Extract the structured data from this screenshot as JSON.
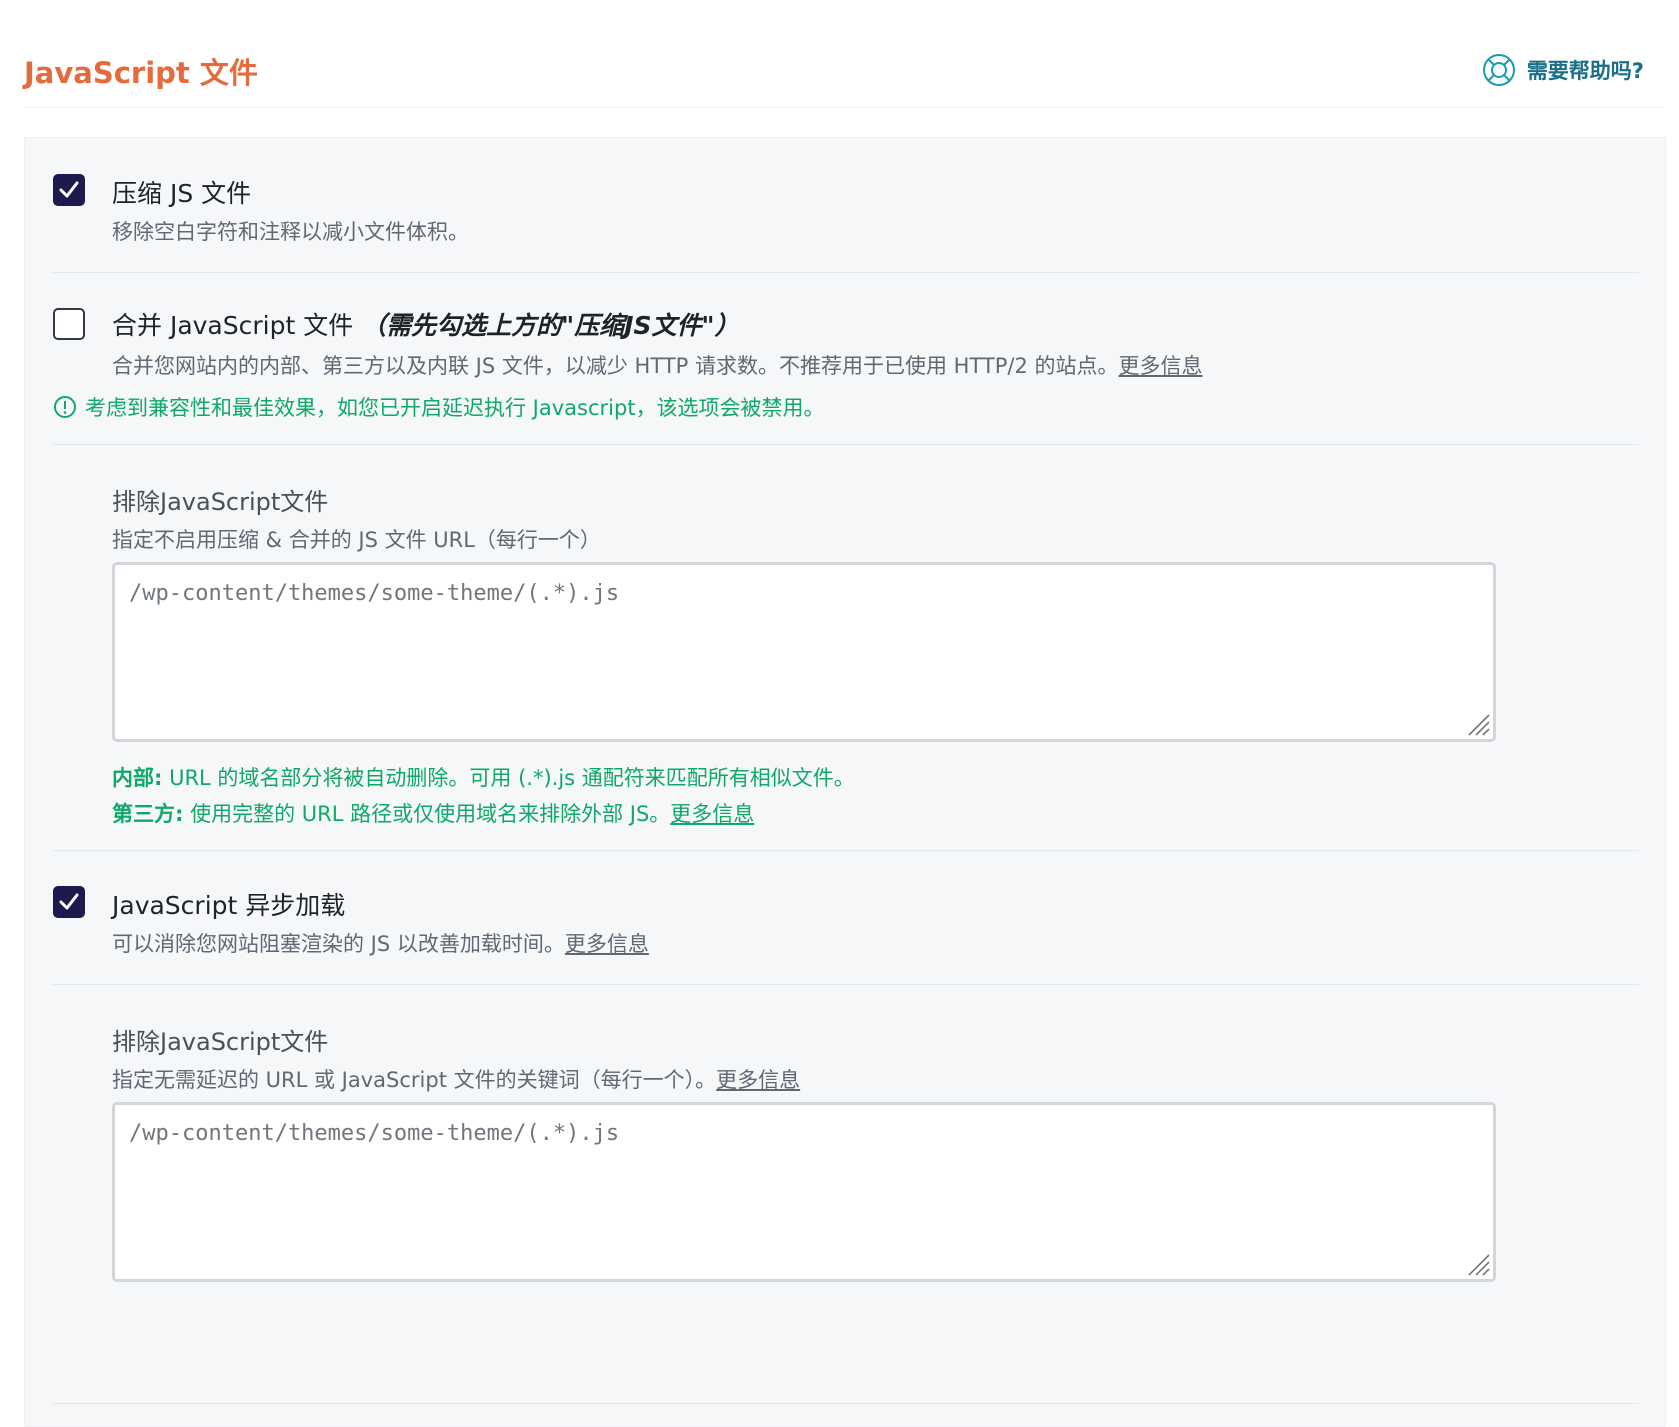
{
  "header": {
    "title": "JavaScript 文件",
    "help_label": "需要帮助吗?"
  },
  "minify": {
    "checked": true,
    "title": "压缩 JS 文件",
    "desc": "移除空白字符和注释以减小文件体积。"
  },
  "combine": {
    "checked": false,
    "title": "合并 JavaScript 文件",
    "note": "（需先勾选上方的\"压缩JS文件\"）",
    "desc": "合并您网站内的内部、第三方以及内联 JS 文件，以减少 HTTP 请求数。不推荐用于已使用 HTTP/2 的站点。",
    "more": "更多信息",
    "warning": "考虑到兼容性和最佳效果，如您已开启延迟执行 Javascript，该选项会被禁用。"
  },
  "exclude_min": {
    "label": "排除JavaScript文件",
    "desc": "指定不启用压缩 & 合并的 JS 文件 URL（每行一个）",
    "placeholder": "/wp-content/themes/some-theme/(.*).js",
    "hint1_bold": "内部:",
    "hint1_text": " URL 的域名部分将被自动删除。可用 (.*).js 通配符来匹配所有相似文件。",
    "hint2_bold": "第三方:",
    "hint2_text": " 使用完整的 URL 路径或仅使用域名来排除外部 JS。",
    "hint2_more": "更多信息"
  },
  "async": {
    "checked": true,
    "title": "JavaScript 异步加载",
    "desc": "可以消除您网站阻塞渲染的 JS 以改善加载时间。",
    "more": "更多信息"
  },
  "exclude_defer": {
    "label": "排除JavaScript文件",
    "desc": "指定无需延迟的 URL 或 JavaScript 文件的关键词（每行一个）。",
    "more": "更多信息",
    "placeholder": "/wp-content/themes/some-theme/(.*).js"
  },
  "colors": {
    "accent_title": "#e46b3d",
    "help": "#1a6f88",
    "checkbox_checked": "#1e1a4d",
    "success": "#10a868"
  }
}
